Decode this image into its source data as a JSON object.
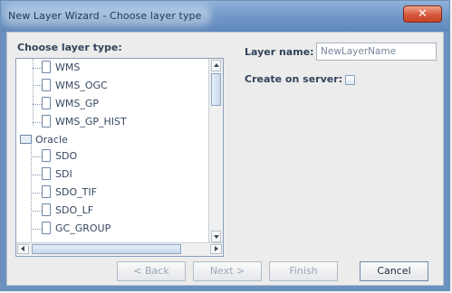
{
  "window": {
    "title": "New Layer Wizard - Choose layer type",
    "close_glyph": "✕"
  },
  "form": {
    "choose_label": "Choose layer type:",
    "name_label": "Layer name:",
    "name_value": "NewLayerName",
    "create_label": "Create on server:",
    "create_checked": false
  },
  "tree": {
    "items": [
      {
        "label": "WMS",
        "type": "doc"
      },
      {
        "label": "WMS_OGC",
        "type": "doc"
      },
      {
        "label": "WMS_GP",
        "type": "doc"
      },
      {
        "label": "WMS_GP_HIST",
        "type": "doc"
      },
      {
        "label": "Oracle",
        "type": "folder"
      },
      {
        "label": "SDO",
        "type": "doc"
      },
      {
        "label": "SDI",
        "type": "doc"
      },
      {
        "label": "SDO_TIF",
        "type": "doc"
      },
      {
        "label": "SDO_LF",
        "type": "doc"
      },
      {
        "label": "GC_GROUP",
        "type": "doc"
      }
    ]
  },
  "buttons": {
    "back": "< Back",
    "next": "Next >",
    "finish": "Finish",
    "cancel": "Cancel"
  }
}
